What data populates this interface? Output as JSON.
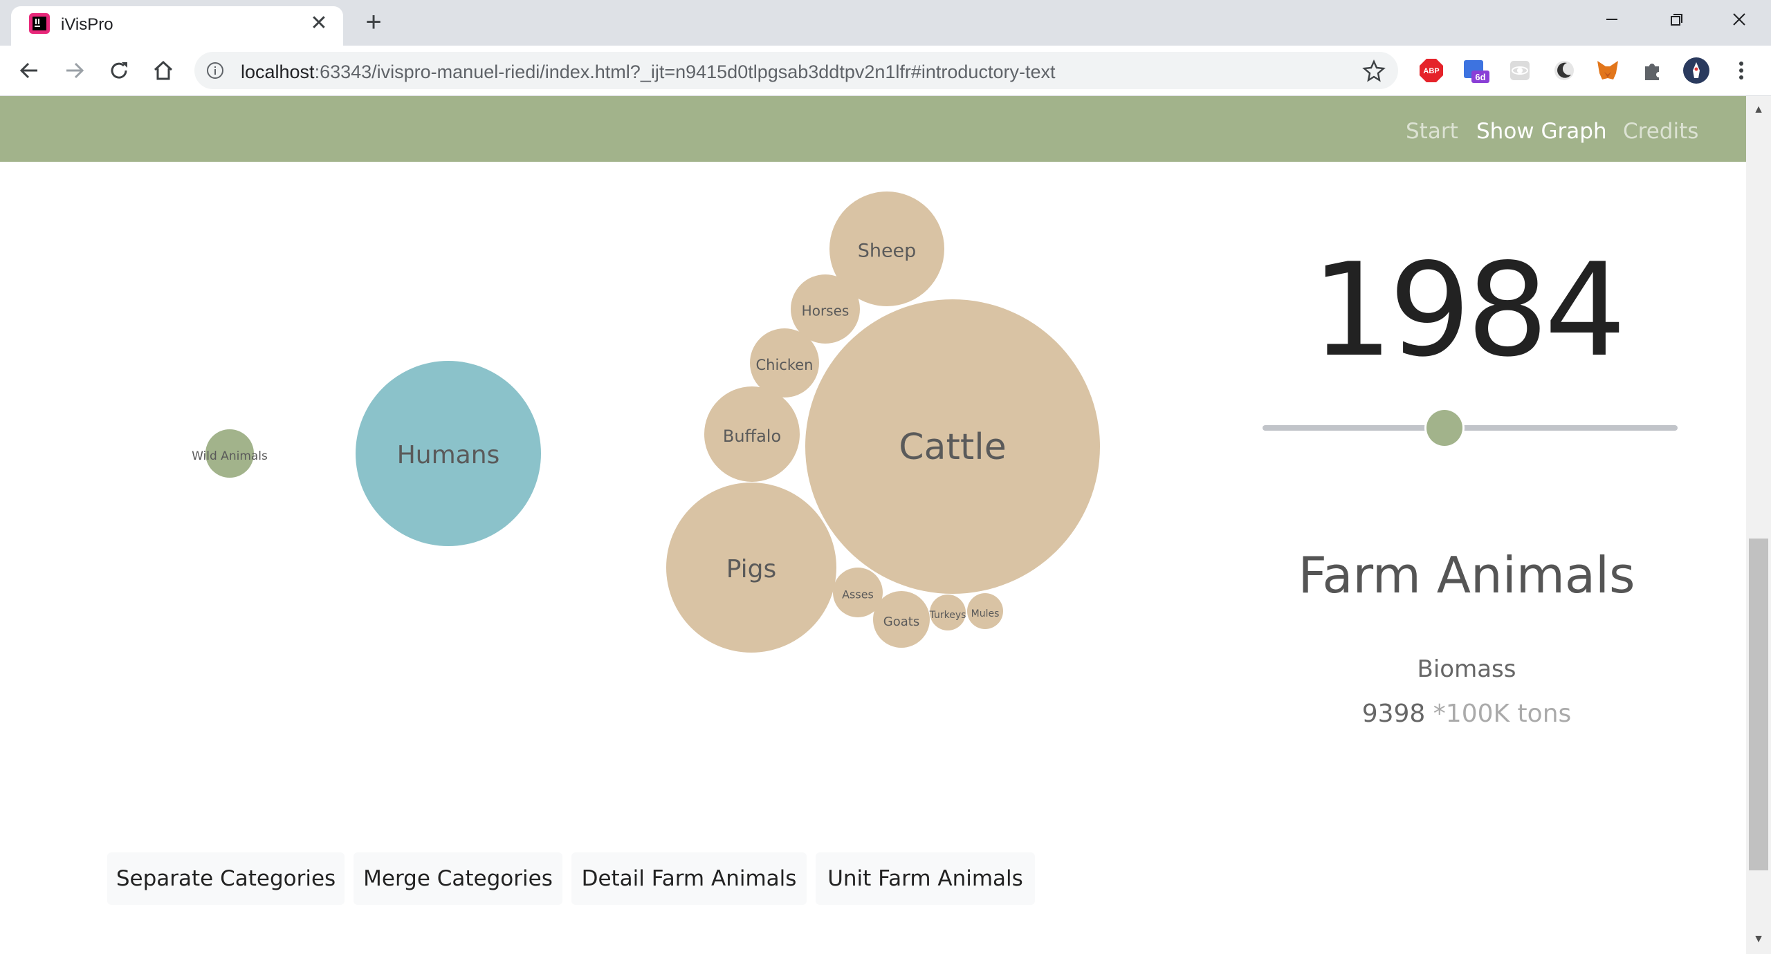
{
  "browser": {
    "tab_title": "iVisPro",
    "url_host": "localhost",
    "url_rest": ":63343/ivispro-manuel-riedi/index.html?_ijt=n9415d0tlpgsab3ddtpv2n1lfr#introductory-text",
    "ext_abp_label": "ABP",
    "ext_cal_badge": "6d"
  },
  "nav": {
    "start": "Start",
    "show_graph": "Show Graph",
    "credits": "Credits"
  },
  "colors": {
    "nav_bg": "#a2b38b",
    "farm": "#d9c3a4",
    "humans": "#8bc2ca",
    "wild": "#a2b38b"
  },
  "chart_data": {
    "type": "bubble",
    "bubbles": [
      {
        "label": "Wild Animals",
        "group": "wild"
      },
      {
        "label": "Humans",
        "group": "humans"
      },
      {
        "label": "Sheep",
        "group": "farm"
      },
      {
        "label": "Horses",
        "group": "farm"
      },
      {
        "label": "Chicken",
        "group": "farm"
      },
      {
        "label": "Buffalo",
        "group": "farm"
      },
      {
        "label": "Cattle",
        "group": "farm"
      },
      {
        "label": "Pigs",
        "group": "farm"
      },
      {
        "label": "Asses",
        "group": "farm"
      },
      {
        "label": "Goats",
        "group": "farm"
      },
      {
        "label": "Turkeys",
        "group": "farm"
      },
      {
        "label": "Mules",
        "group": "farm"
      }
    ]
  },
  "panel": {
    "year": "1984",
    "slider_fraction": 0.44,
    "category": "Farm Animals",
    "metric_label": "Biomass",
    "metric_value": "9398",
    "metric_unit": "*100K tons"
  },
  "buttons": {
    "separate": "Separate Categories",
    "merge": "Merge Categories",
    "detail": "Detail Farm Animals",
    "unit": "Unit Farm Animals"
  }
}
